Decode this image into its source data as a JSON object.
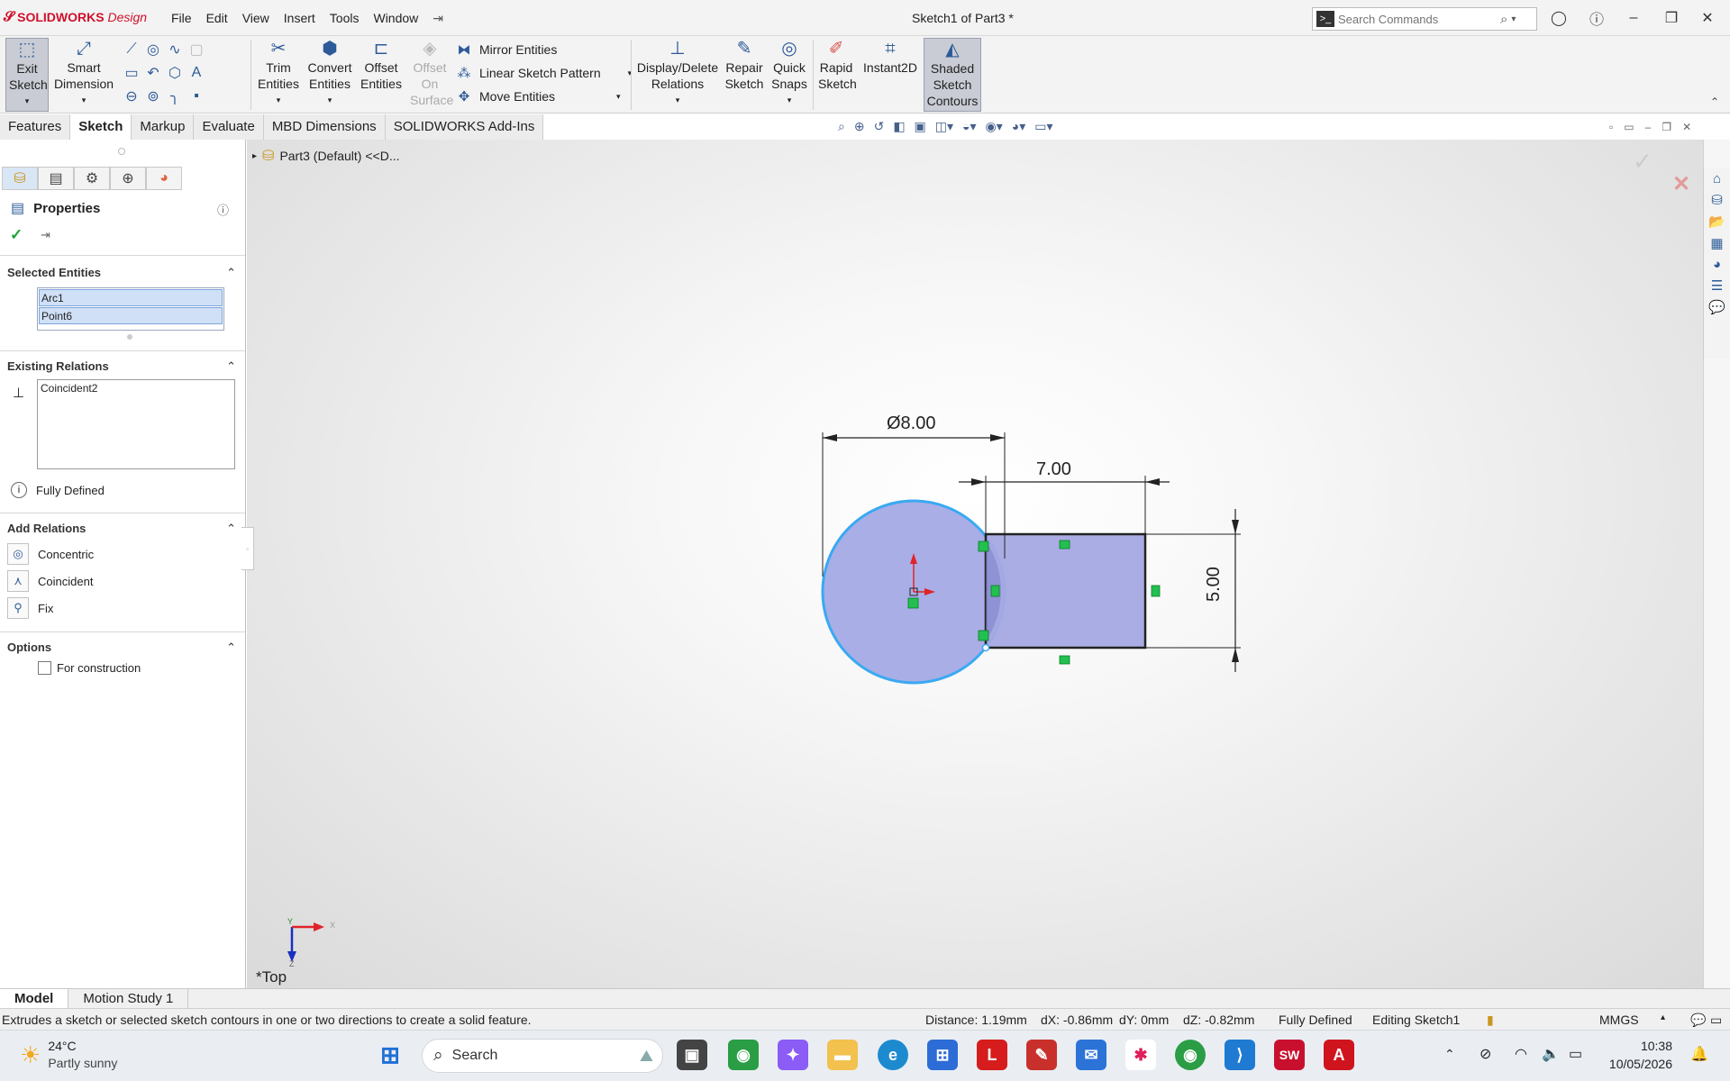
{
  "app": {
    "brand": "SOLIDWORKS",
    "brand_suffix": "Design",
    "doc_title": "Sketch1 of Part3 *"
  },
  "menu": [
    "File",
    "Edit",
    "View",
    "Insert",
    "Tools",
    "Window"
  ],
  "search": {
    "placeholder": "Search Commands"
  },
  "ribbon": {
    "exit_sketch": "Exit Sketch",
    "smart_dimension": "Smart Dimension",
    "trim": "Trim Entities",
    "convert": "Convert Entities",
    "offset": "Offset Entities",
    "offset_surface": "Offset On Surface",
    "mirror": "Mirror Entities",
    "linear_pattern": "Linear Sketch Pattern",
    "move": "Move Entities",
    "display_delete": "Display/Delete Relations",
    "repair": "Repair Sketch",
    "quick_snaps": "Quick Snaps",
    "rapid_sketch": "Rapid Sketch",
    "instant2d": "Instant2D",
    "shaded": "Shaded Sketch Contours"
  },
  "cm_tabs": [
    "Features",
    "Sketch",
    "Markup",
    "Evaluate",
    "MBD Dimensions",
    "SOLIDWORKS Add-Ins"
  ],
  "panel": {
    "title": "Properties",
    "selected_entities_label": "Selected Entities",
    "selected_entities": [
      "Arc1",
      "Point6"
    ],
    "existing_relations_label": "Existing Relations",
    "existing_relations": [
      "Coincident2"
    ],
    "status": "Fully Defined",
    "add_relations_label": "Add Relations",
    "add_relations": [
      "Concentric",
      "Coincident",
      "Fix"
    ],
    "options_label": "Options",
    "for_construction": "For construction"
  },
  "feature_path": "Part3 (Default) <<D...",
  "sketch": {
    "dim_diameter": "Ø8.00",
    "dim_width": "7.00",
    "dim_height": "5.00",
    "view_label": "*Top"
  },
  "bottom_tabs": [
    "Model",
    "Motion Study 1"
  ],
  "status": {
    "hint": "Extrudes a sketch or selected sketch contours in one or two directions to create a solid feature.",
    "distance": "Distance: 1.19mm",
    "dx": "dX: -0.86mm",
    "dy": "dY: 0mm",
    "dz": "dZ: -0.82mm",
    "defined": "Fully Defined",
    "editing": "Editing Sketch1",
    "units": "MMGS"
  },
  "taskbar": {
    "weather_temp": "24°C",
    "weather_desc": "Partly sunny",
    "search": "Search",
    "time": "10:38",
    "date": "10/05/2026"
  },
  "colors": {
    "accent": "#2d5b99",
    "sketch_fill": "#aaaee6",
    "sketch_line": "#39a8f0",
    "relation": "#1dbb4c"
  }
}
